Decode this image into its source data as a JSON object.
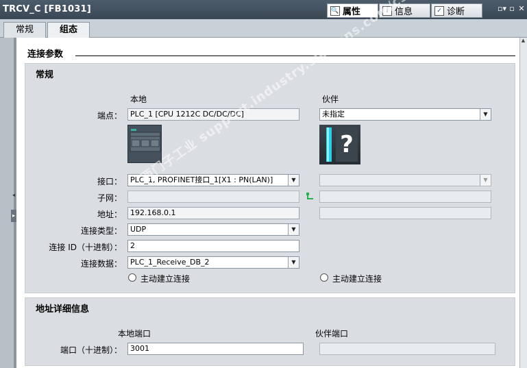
{
  "window": {
    "title": "TRCV_C [FB1031]",
    "panel_tabs": [
      {
        "label": "属性",
        "icon": "properties-icon",
        "active": true
      },
      {
        "label": "信息",
        "icon": "info-icon",
        "active": false
      },
      {
        "label": "诊断",
        "icon": "diagnostics-icon",
        "active": false
      }
    ]
  },
  "tabs": [
    {
      "label": "常规",
      "active": false
    },
    {
      "label": "组态",
      "active": true
    }
  ],
  "section": {
    "title": "连接参数"
  },
  "general": {
    "title": "常规",
    "local_header": "本地",
    "partner_header": "伙伴",
    "endpoint": {
      "label": "端点：",
      "local": "PLC_1 [CPU 1212C DC/DC/DC]",
      "partner": "未指定"
    },
    "interface": {
      "label": "接口：",
      "local": "PLC_1, PROFINET接口_1[X1 : PN(LAN)]",
      "partner": ""
    },
    "subnet": {
      "label": "子网：",
      "local": "",
      "partner": ""
    },
    "address": {
      "label": "地址：",
      "local": "192.168.0.1",
      "partner": ""
    },
    "conn_type": {
      "label": "连接类型：",
      "value": "UDP"
    },
    "conn_id": {
      "label": "连接 ID（十进制）：",
      "value": "2"
    },
    "conn_data": {
      "label": "连接数据：",
      "value": "PLC_1_Receive_DB_2"
    },
    "active_local": "主动建立连接",
    "active_partner": "主动建立连接",
    "partner_image_glyph": "?"
  },
  "address_details": {
    "title": "地址详细信息",
    "local_port_header": "本地端口",
    "partner_port_header": "伙伴端口",
    "port_label": "端口（十进制）：",
    "local_port": "3001",
    "partner_port": ""
  },
  "watermark": "西门子工业 support.industry.siemens.com/cs 找答案"
}
